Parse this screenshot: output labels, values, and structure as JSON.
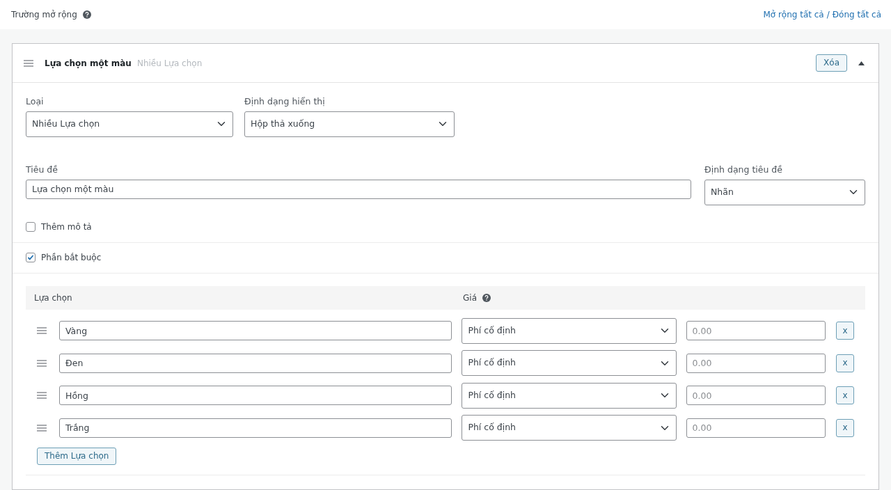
{
  "header": {
    "title": "Trường mở rộng",
    "expand_all": "Mở rộng tất cả",
    "separator": "/",
    "collapse_all": "Đóng tất cả"
  },
  "field": {
    "title": "Lựa chọn một màu",
    "type_label": "Nhiều Lựa chọn",
    "delete_button": "Xóa",
    "expanded": true,
    "type": {
      "label": "Loại",
      "value": "Nhiều Lựa chọn"
    },
    "display": {
      "label": "Định dạng hiển thị",
      "value": "Hộp thả xuống"
    },
    "field_title": {
      "label": "Tiêu đề",
      "value": "Lựa chọn một màu"
    },
    "title_format": {
      "label": "Định dạng tiêu đề",
      "value": "Nhãn"
    },
    "checkboxes": [
      {
        "label": "Thêm mô tả",
        "checked": false
      },
      {
        "label": "Phần bắt buộc",
        "checked": true
      }
    ],
    "options": {
      "columns": [
        "Lựa chọn",
        "Giá"
      ],
      "rows": [
        {
          "name": "Vàng",
          "price_type": "Phí cố định",
          "price_placeholder": "0.00",
          "remove": "x"
        },
        {
          "name": "Đen",
          "price_type": "Phí cố định",
          "price_placeholder": "0.00",
          "remove": "x"
        },
        {
          "name": "Hồng",
          "price_type": "Phí cố định",
          "price_placeholder": "0.00",
          "remove": "x"
        },
        {
          "name": "Trắng",
          "price_type": "Phí cố định",
          "price_placeholder": "0.00",
          "remove": "x"
        }
      ],
      "add_button": "Thêm Lựa chọn"
    }
  }
}
